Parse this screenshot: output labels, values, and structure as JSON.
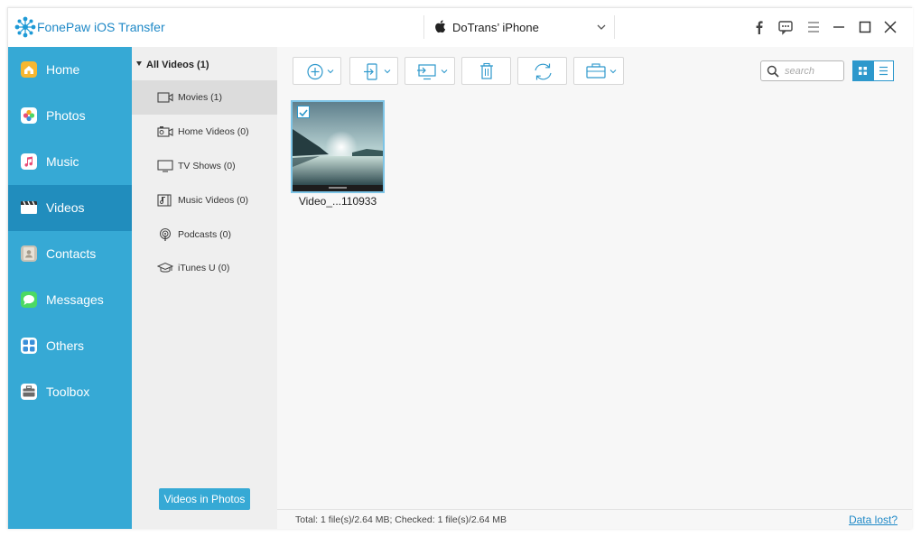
{
  "app": {
    "title": "FonePaw iOS Transfer"
  },
  "device": {
    "name": "DoTrans’ iPhone"
  },
  "sidebar": {
    "items": [
      {
        "label": "Home",
        "icon": "home-icon",
        "color": "#f5a623"
      },
      {
        "label": "Photos",
        "icon": "photos-icon",
        "color": "#e94e77"
      },
      {
        "label": "Music",
        "icon": "music-icon",
        "color": "#e94e77"
      },
      {
        "label": "Videos",
        "icon": "videos-icon",
        "color": "#333333"
      },
      {
        "label": "Contacts",
        "icon": "contacts-icon",
        "color": "#b9b9b9"
      },
      {
        "label": "Messages",
        "icon": "messages-icon",
        "color": "#4cd964"
      },
      {
        "label": "Others",
        "icon": "others-icon",
        "color": "#3a8fd9"
      },
      {
        "label": "Toolbox",
        "icon": "toolbox-icon",
        "color": "#555555"
      }
    ],
    "active": "Videos",
    "videos_in_photos": "Videos in Photos"
  },
  "sublist": {
    "header": "All Videos (1)",
    "items": [
      {
        "label": "Movies (1)",
        "icon": "movie-icon"
      },
      {
        "label": "Home Videos (0)",
        "icon": "home-video-icon"
      },
      {
        "label": "TV Shows (0)",
        "icon": "tv-icon"
      },
      {
        "label": "Music Videos (0)",
        "icon": "music-video-icon"
      },
      {
        "label": "Podcasts (0)",
        "icon": "podcast-icon"
      },
      {
        "label": "iTunes U (0)",
        "icon": "itunes-u-icon"
      }
    ],
    "active": "Movies (1)"
  },
  "search": {
    "placeholder": "search",
    "value": ""
  },
  "files": [
    {
      "name": "Video_...110933",
      "checked": true
    }
  ],
  "status": {
    "text": "Total: 1 file(s)/2.64 MB; Checked: 1 file(s)/2.64 MB",
    "data_lost": "Data lost?"
  },
  "colors": {
    "accent": "#36a9d5",
    "sidebar_active": "#218dbd",
    "link": "#1f89c7"
  }
}
